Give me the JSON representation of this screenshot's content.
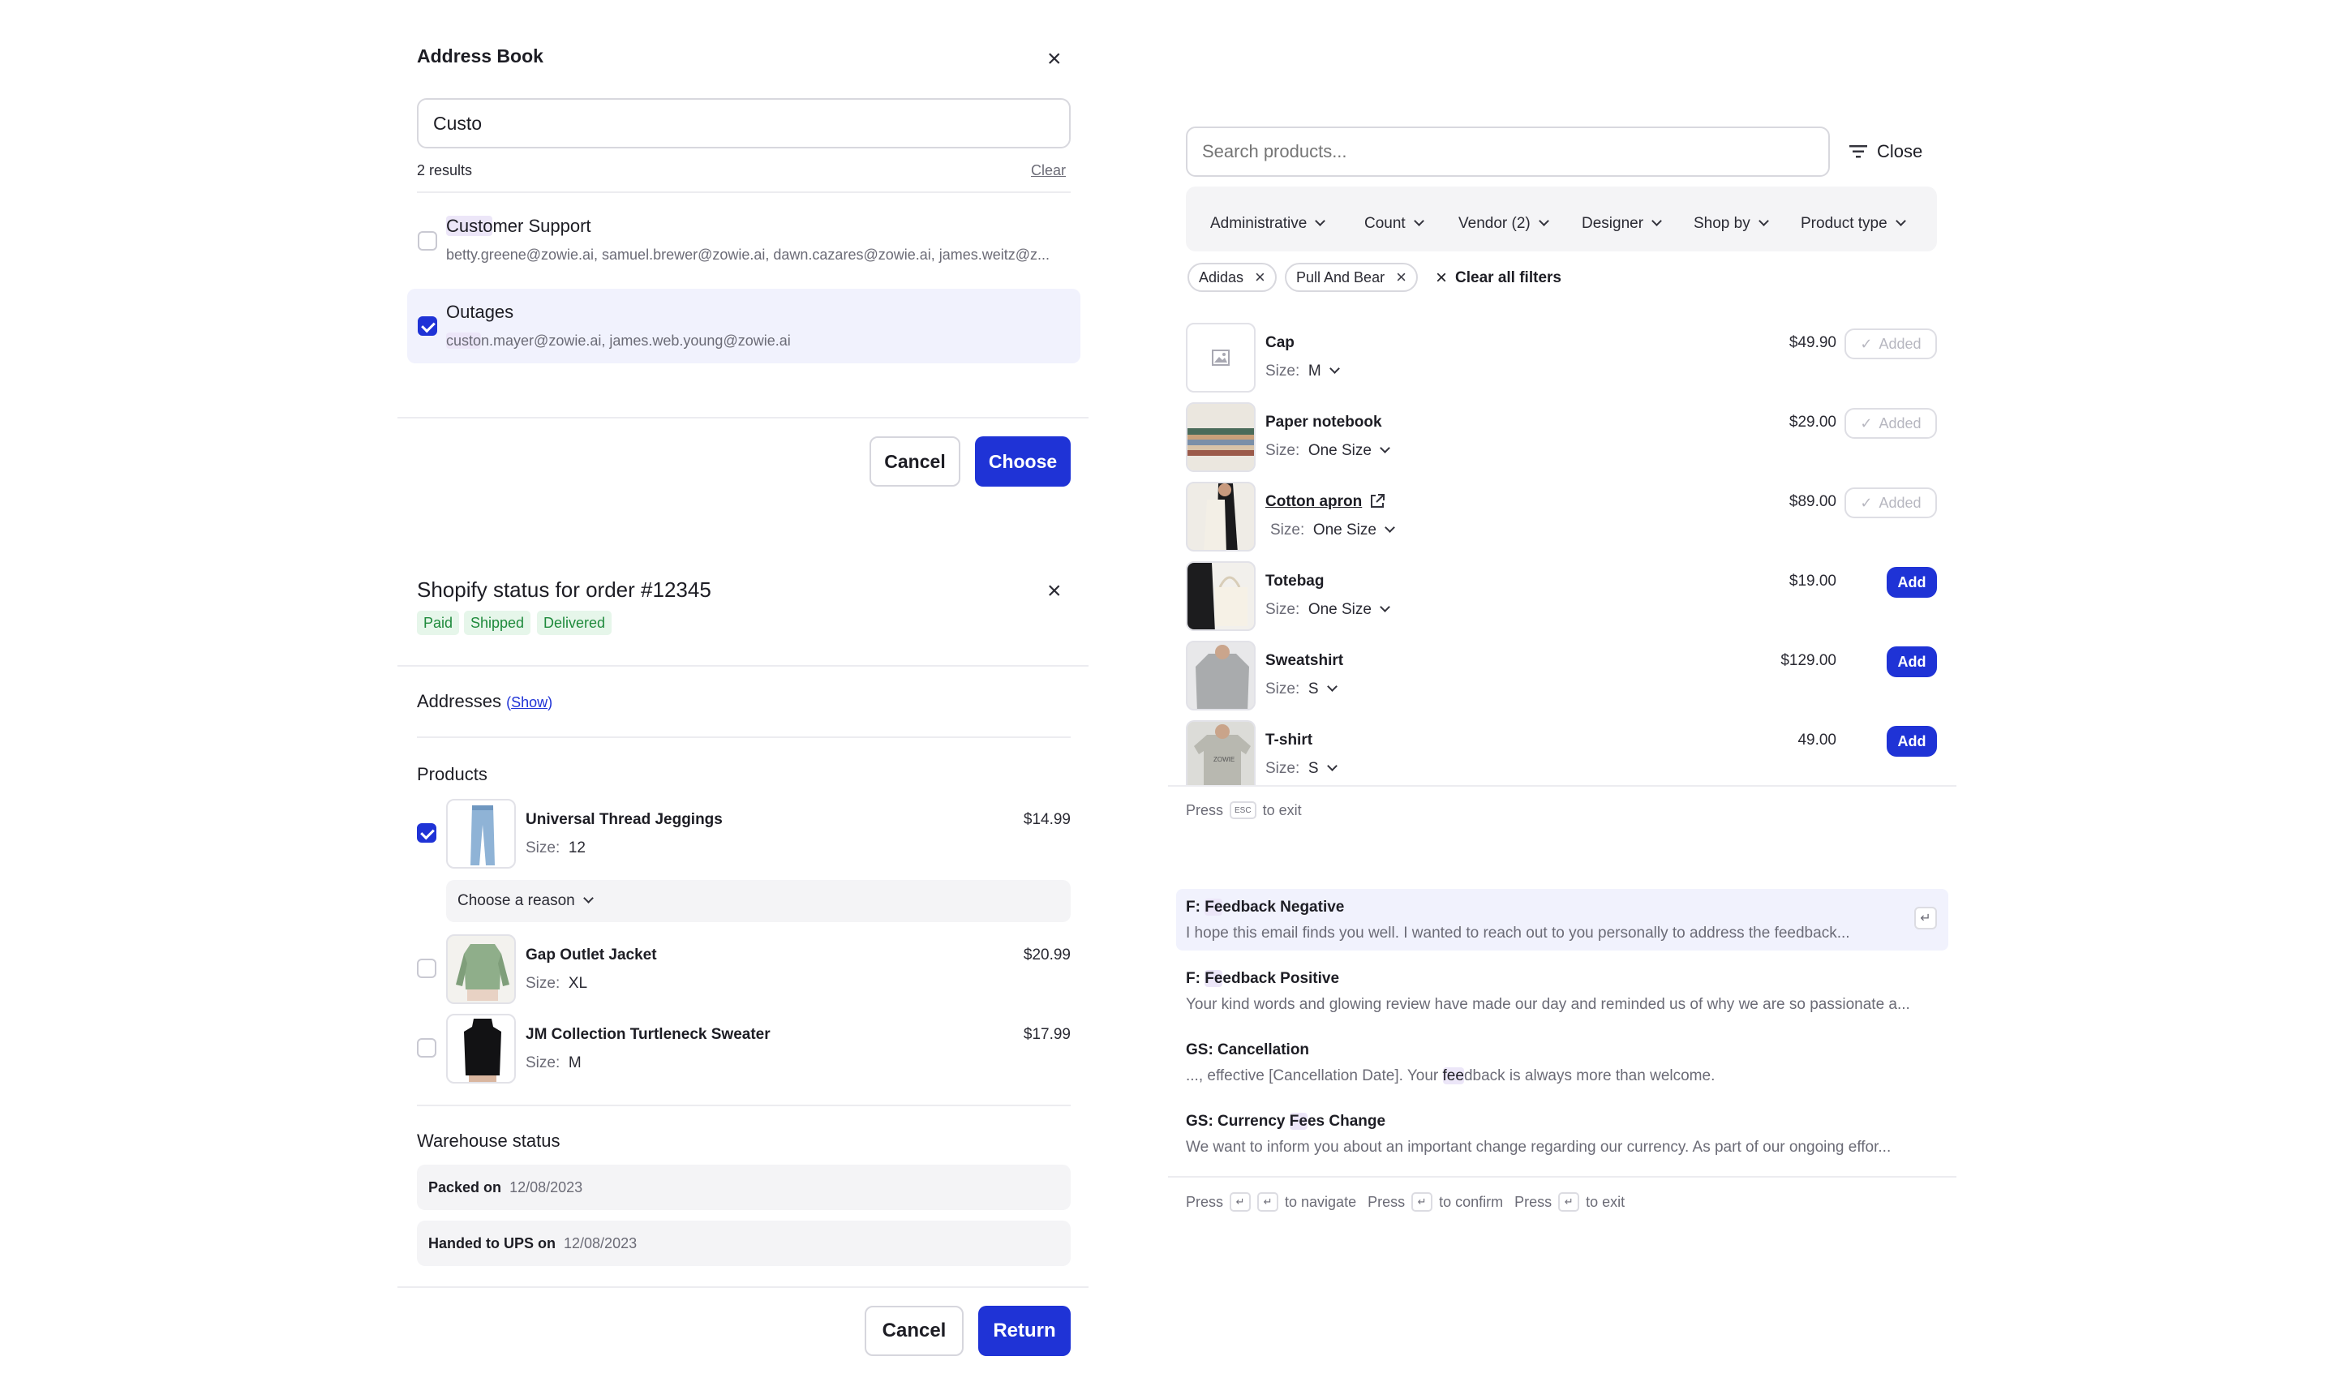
{
  "address_book": {
    "title": "Address Book",
    "search_value": "Custo",
    "results_count": "2 results",
    "clear_label": "Clear",
    "items": [
      {
        "name_match": "Custo",
        "name_rest": "mer Support",
        "emails_match": "",
        "emails_rest": "betty.greene@zowie.ai, samuel.brewer@zowie.ai, dawn.cazares@zowie.ai, james.weitz@z...",
        "checked": false
      },
      {
        "name_match": "",
        "name_rest": "Outages",
        "emails_match": "custo",
        "emails_rest": "n.mayer@zowie.ai, james.web.young@zowie.ai",
        "checked": true
      }
    ],
    "cancel_label": "Cancel",
    "choose_label": "Choose"
  },
  "order_status": {
    "title": "Shopify status for order #12345",
    "tags": [
      "Paid",
      "Shipped",
      "Delivered"
    ],
    "addresses_label": "Addresses",
    "addresses_open": "(",
    "show_label": "Show",
    "addresses_close": ")",
    "products_label": "Products",
    "products": [
      {
        "name": "Universal Thread Jeggings",
        "size_label": "Size:",
        "size": "12",
        "price": "$14.99",
        "checked": true
      },
      {
        "name": "Gap Outlet Jacket",
        "size_label": "Size:",
        "size": "XL",
        "price": "$20.99",
        "checked": false
      },
      {
        "name": "JM Collection Turtleneck Sweater",
        "size_label": "Size:",
        "size": "M",
        "price": "$17.99",
        "checked": false
      }
    ],
    "reason_label": "Choose a reason",
    "warehouse_label": "Warehouse status",
    "warehouse": [
      {
        "label": "Packed on",
        "date": "12/08/2023"
      },
      {
        "label": "Handed to UPS on",
        "date": "12/08/2023"
      }
    ],
    "cancel_label": "Cancel",
    "return_label": "Return"
  },
  "product_search": {
    "placeholder": "Search products...",
    "close_label": "Close",
    "filters": [
      "Administrative",
      "Count",
      "Vendor (2)",
      "Designer",
      "Shop by",
      "Product type"
    ],
    "active_filters": [
      "Adidas",
      "Pull And Bear"
    ],
    "clear_all_label": "Clear all filters",
    "products": [
      {
        "name": "Cap",
        "size_label": "Size:",
        "size": "M",
        "price": "$49.90",
        "state": "Added",
        "link": false
      },
      {
        "name": "Paper notebook",
        "size_label": "Size:",
        "size": "One Size",
        "price": "$29.00",
        "state": "Added",
        "link": false
      },
      {
        "name": "Cotton apron",
        "size_label": "Size:",
        "size": "One Size",
        "price": "$89.00",
        "state": "Added",
        "link": true
      },
      {
        "name": "Totebag",
        "size_label": "Size:",
        "size": "One Size",
        "price": "$19.00",
        "state": "Add",
        "link": false
      },
      {
        "name": "Sweatshirt",
        "size_label": "Size:",
        "size": "S",
        "price": "$129.00",
        "state": "Add",
        "link": false
      },
      {
        "name": "T-shirt",
        "size_label": "Size:",
        "size": "S",
        "price": "49.00",
        "state": "Add",
        "link": false
      }
    ],
    "footer_press": "Press",
    "footer_key": "ESC",
    "footer_exit": "to exit",
    "tshirt_print": "ZOWIE"
  },
  "templates": {
    "items": [
      {
        "prefix": "F: ",
        "title_match": "Fe",
        "title_rest": "edback Negative",
        "body_pre": "",
        "body_match": "",
        "body_rest": "I hope this email finds you well. I wanted to reach out to you personally to address the feedback..."
      },
      {
        "prefix": "F: ",
        "title_match": "Fe",
        "title_rest": "edback Positive",
        "body_pre": "",
        "body_match": "",
        "body_rest": "Your kind words and glowing review have made our day and reminded us of why we are so passionate a..."
      },
      {
        "prefix": "GS: Cancellation",
        "title_match": "",
        "title_rest": "",
        "body_pre": "..., effective [Cancellation Date]. Your ",
        "body_match": "fee",
        "body_rest": "dback is always more than welcome."
      },
      {
        "prefix": "GS: Currency ",
        "title_match": "Fe",
        "title_rest": "es Change",
        "body_pre": "",
        "body_match": "",
        "body_rest": "We want to inform you about an important change regarding our currency. As part of our ongoing effor..."
      }
    ],
    "footer": {
      "press1": "Press",
      "navigate": "to navigate",
      "press2": "Press",
      "confirm": "to confirm",
      "press3": "Press",
      "exit": "to exit"
    }
  },
  "colors": {
    "primary": "#1f33d6",
    "selected_row": "#f1f2fd",
    "highlight": "#ece6f8",
    "tag_green": "#1f8a3c"
  }
}
